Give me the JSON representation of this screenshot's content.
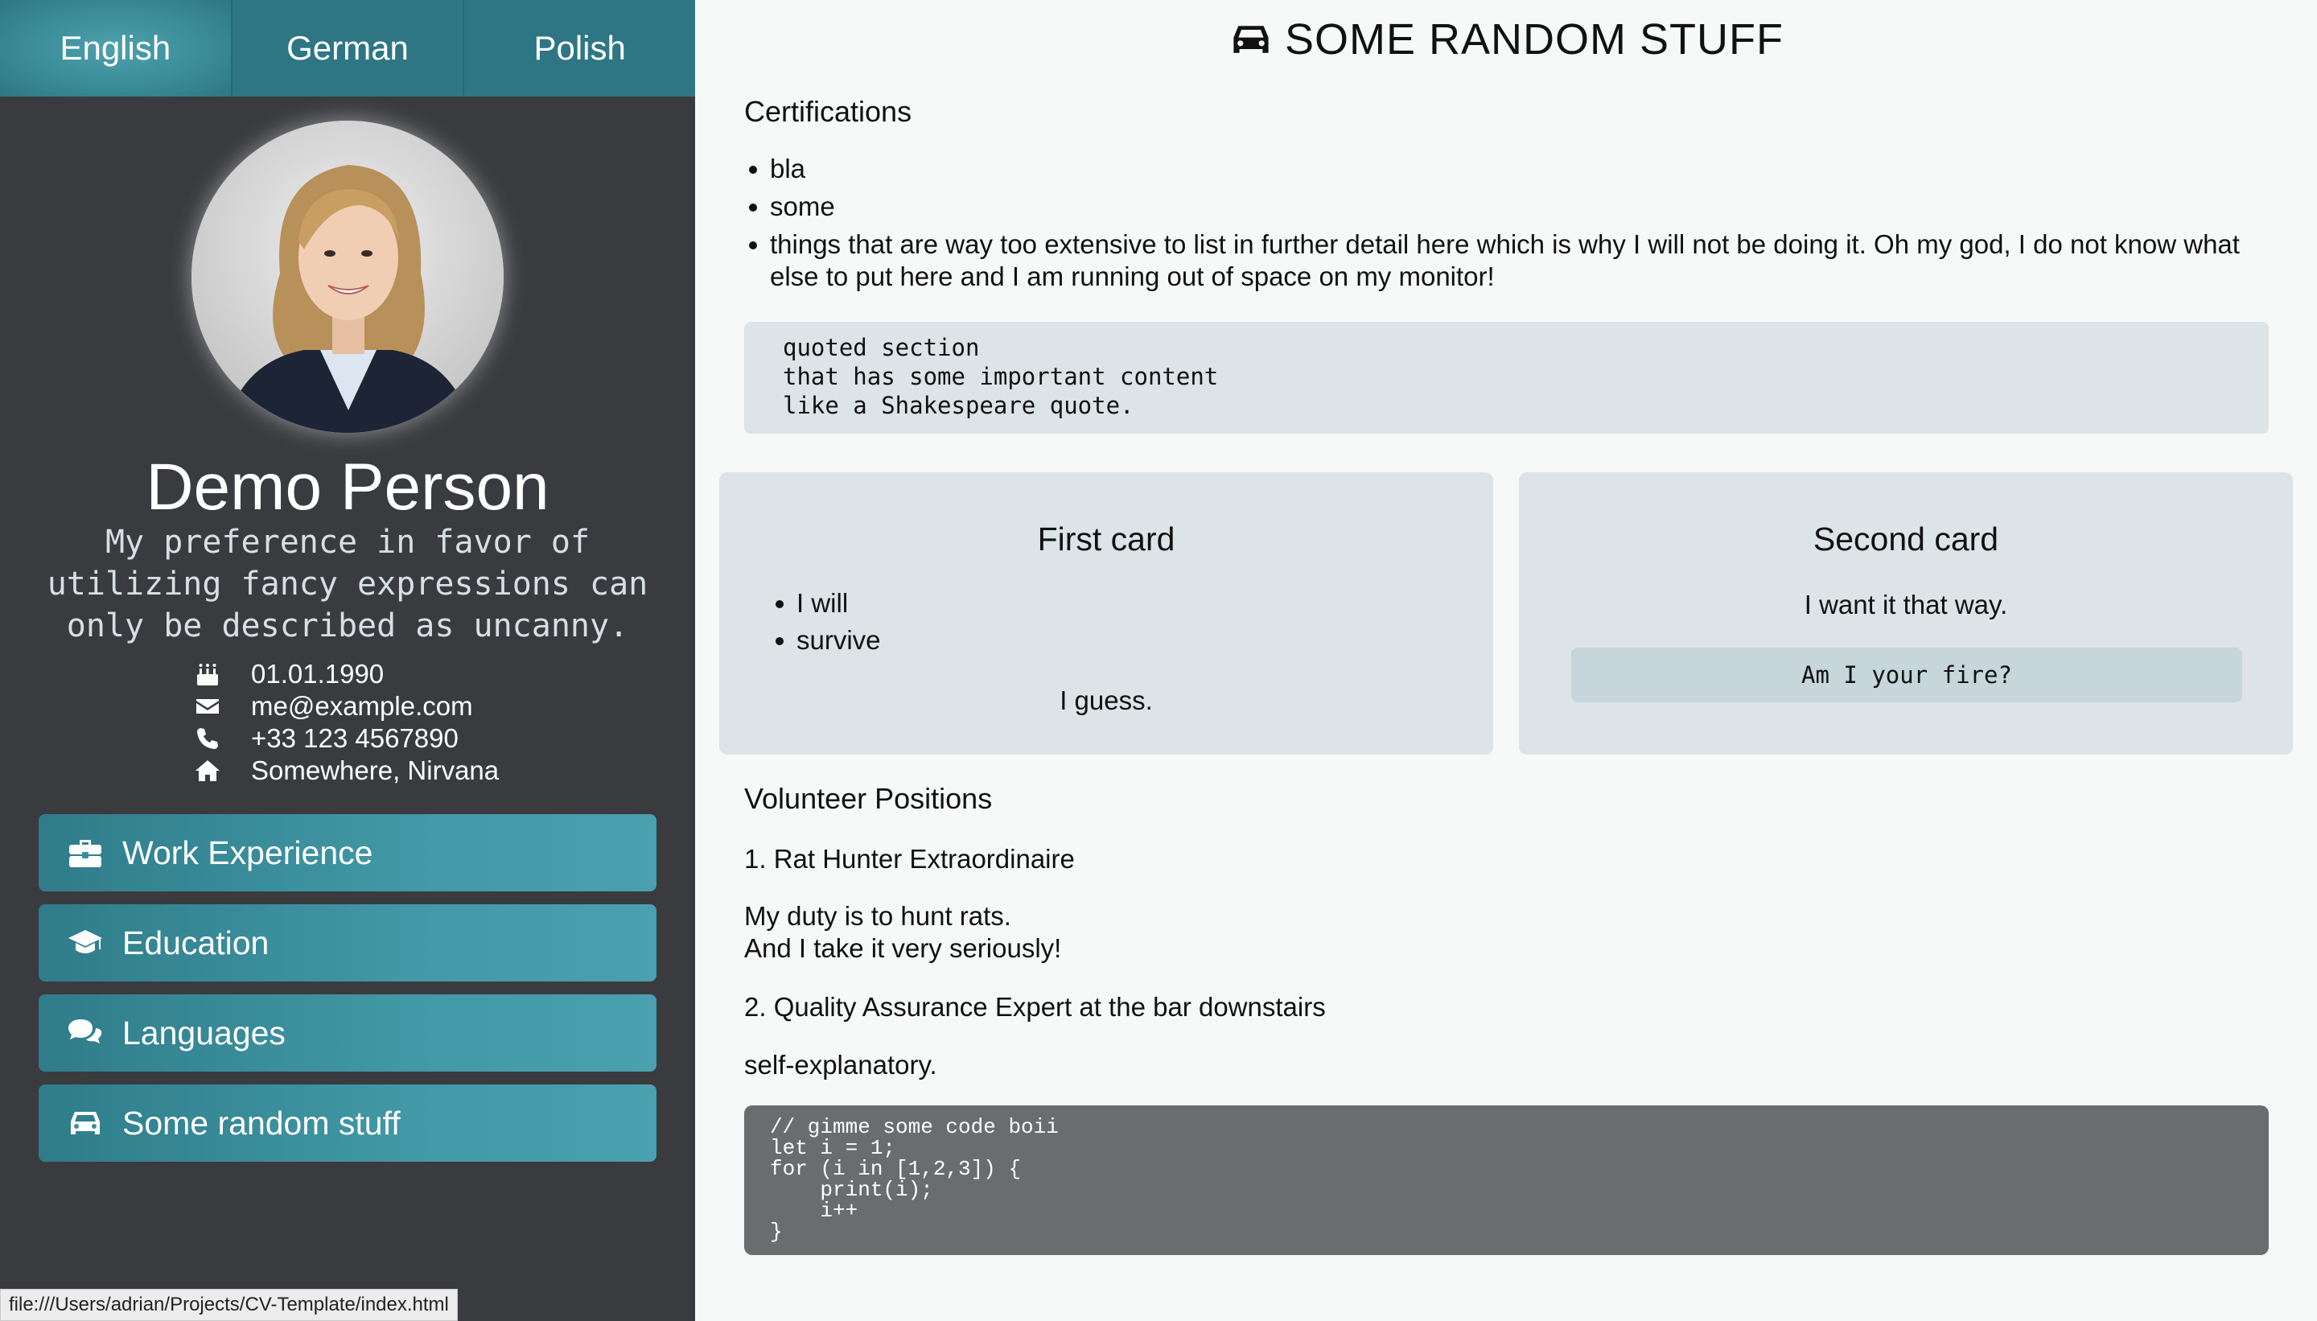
{
  "sidebar": {
    "languages": [
      {
        "label": "English",
        "active": true
      },
      {
        "label": "German",
        "active": false
      },
      {
        "label": "Polish",
        "active": false
      }
    ],
    "name": "Demo Person",
    "tagline": "My preference in favor of utilizing fancy expressions can only be described as uncanny.",
    "contacts": [
      {
        "icon": "birthday-cake-icon",
        "value": "01.01.1990"
      },
      {
        "icon": "envelope-icon",
        "value": "me@example.com"
      },
      {
        "icon": "phone-icon",
        "value": "+33 123 4567890"
      },
      {
        "icon": "home-icon",
        "value": "Somewhere, Nirvana"
      }
    ],
    "nav": [
      {
        "icon": "briefcase-icon",
        "label": "Work Experience"
      },
      {
        "icon": "graduation-cap-icon",
        "label": "Education"
      },
      {
        "icon": "comments-icon",
        "label": "Languages"
      },
      {
        "icon": "car-icon",
        "label": "Some random stuff"
      }
    ],
    "accent_color": "#2e7683",
    "background_color": "#3a3b3f"
  },
  "status_bar": {
    "url": "file:///Users/adrian/Projects/CV-Template/index.html"
  },
  "main": {
    "title": "SOME RANDOM STUFF",
    "title_icon": "car-icon",
    "certifications": {
      "heading": "Certifications",
      "items": [
        "bla",
        "some",
        "things that are way too extensive to list in further detail here which is why I will not be doing it. Oh my god, I do not know what else to put here and I am running out of space on my monitor!"
      ]
    },
    "quote": "quoted section\nthat has some important content\nlike a Shakespeare quote.",
    "cards": [
      {
        "title": "First card",
        "items": [
          "I will",
          "survive"
        ],
        "footer": "I guess."
      },
      {
        "title": "Second card",
        "text": "I want it that way.",
        "code": "Am I your fire?"
      }
    ],
    "volunteer": {
      "heading": "Volunteer Positions",
      "positions": [
        {
          "title": "1. Rat Hunter Extraordinaire",
          "description_lines": [
            "My duty is to hunt rats.",
            "And I take it very seriously!"
          ]
        },
        {
          "title": "2. Quality Assurance Expert at the bar downstairs",
          "description_lines": [
            "self-explanatory."
          ]
        }
      ]
    },
    "code": "// gimme some code boii\nlet i = 1;\nfor (i in [1,2,3]) {\n    print(i);\n    i++\n}"
  }
}
